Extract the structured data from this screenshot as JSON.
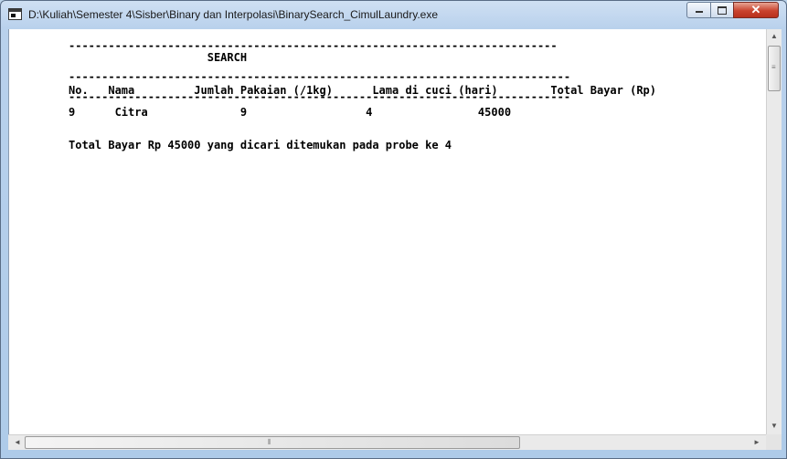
{
  "window": {
    "title": "D:\\Kuliah\\Semester 4\\Sisber\\Binary dan Interpolasi\\BinarySearch_CimulLaundry.exe",
    "controls": {
      "minimize": "",
      "maximize": "",
      "close": "✕"
    }
  },
  "console": {
    "lines": [
      "--------------------------------------------------------------------------",
      "                     SEARCH",
      "----------------------------------------------------------------------------",
      "No.   Nama         Jumlah Pakaian (/1kg)      Lama di cuci (hari)        Total Bayar (Rp)",
      "----------------------------------------------------------------------------",
      "9      Citra              9                  4                45000",
      "Total Bayar Rp 45000 yang dicari ditemukan pada probe ke 4"
    ]
  },
  "scrollbars": {
    "vertical": {
      "up_arrow": "▲",
      "down_arrow": "▼",
      "grip": "≡"
    },
    "horizontal": {
      "left_arrow": "◄",
      "right_arrow": "►",
      "grip": "⦀"
    }
  }
}
